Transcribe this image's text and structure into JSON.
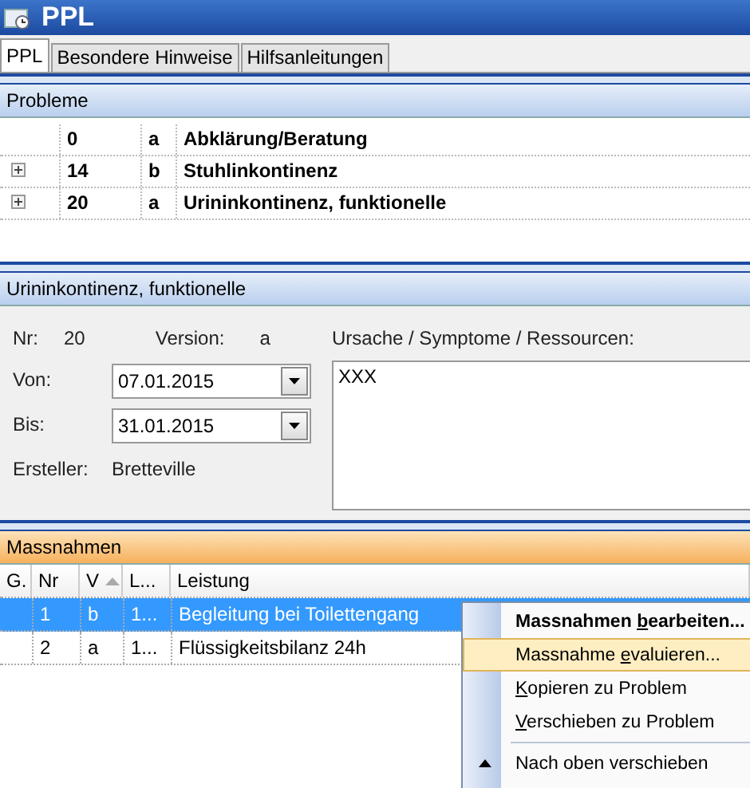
{
  "window": {
    "title": "PPL"
  },
  "tabs": [
    {
      "label": "PPL",
      "selected": true
    },
    {
      "label": "Besondere Hinweise",
      "selected": false
    },
    {
      "label": "Hilfsanleitungen",
      "selected": false
    }
  ],
  "problems": {
    "header": "Probleme",
    "rows": [
      {
        "nr": "0",
        "version": "a",
        "name": "Abklärung/Beratung",
        "expandable": false
      },
      {
        "nr": "14",
        "version": "b",
        "name": "Stuhlinkontinenz",
        "expandable": true
      },
      {
        "nr": "20",
        "version": "a",
        "name": "Urininkontinenz, funktionelle",
        "expandable": true
      }
    ]
  },
  "detail": {
    "header": "Urininkontinenz, funktionelle",
    "nr_label": "Nr:",
    "nr": "20",
    "version_label": "Version:",
    "version": "a",
    "von_label": "Von:",
    "von": "07.01.2015",
    "bis_label": "Bis:",
    "bis": "31.01.2015",
    "ersteller_label": "Ersteller:",
    "ersteller": "Bretteville",
    "notes_label": "Ursache / Symptome / Ressourcen:",
    "notes": "XXX"
  },
  "measures": {
    "header": "Massnahmen",
    "columns": [
      "G.",
      "Nr",
      "V",
      "L...",
      "Leistung"
    ],
    "rows": [
      {
        "cells": [
          "",
          "1",
          "b",
          "1...",
          "Begleitung bei Toilettengang"
        ],
        "selected": true
      },
      {
        "cells": [
          "",
          "2",
          "a",
          "1...",
          "Flüssigkeitsbilanz 24h"
        ],
        "selected": false
      }
    ]
  },
  "context_menu": {
    "items": [
      {
        "pre": "Massnahmen ",
        "key": "b",
        "post": "earbeiten...",
        "default": true,
        "highlighted": false,
        "kind": "item"
      },
      {
        "pre": "Massnahme ",
        "key": "e",
        "post": "valuieren...",
        "default": false,
        "highlighted": true,
        "kind": "item"
      },
      {
        "key": "K",
        "post": "opieren zu Problem",
        "default": false,
        "highlighted": false,
        "kind": "item"
      },
      {
        "key": "V",
        "post": "erschieben zu Problem",
        "default": false,
        "highlighted": false,
        "kind": "item"
      },
      {
        "kind": "separator"
      },
      {
        "pre": "Nach oben verschieben",
        "default": false,
        "highlighted": false,
        "kind": "up"
      }
    ]
  }
}
